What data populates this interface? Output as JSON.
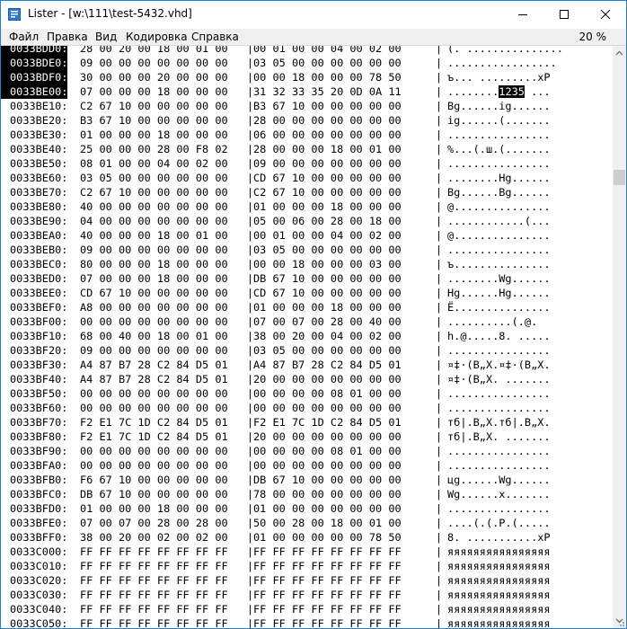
{
  "window": {
    "title": "Lister - [w:\\111\\test-5432.vhd]"
  },
  "menu": {
    "items": [
      "Файл",
      "Правка",
      "Вид",
      "Кодировка",
      "Справка"
    ],
    "zoom": "20 %"
  },
  "colors": {
    "selection": "#000000",
    "title_icon": "#2d7bd6",
    "border": "#1883d7"
  },
  "rows": [
    {
      "addr": "0033BDD0:",
      "hex1": "28 00 20 00 18 00 01 00",
      "hex2": "00 01 00 00 04 00 02 00",
      "ascii": "(. ...............",
      "sel": true,
      "selfrom": 2
    },
    {
      "addr": "0033BDE0:",
      "hex1": "09 00 00 00 00 00 00 00",
      "hex2": "03 05 00 00 00 00 00 00",
      "ascii": ".................",
      "sel": true,
      "selfrom": 2
    },
    {
      "addr": "0033BDF0:",
      "hex1": "30 00 00 00 20 00 00 00",
      "hex2": "00 00 18 00 00 00 78 50",
      "ascii": "ъ... .........xP",
      "sel": true,
      "selfrom": 2
    },
    {
      "addr": "0033BE00:",
      "hex1": "07 00 00 00 18 00 00 00",
      "hex2": "31 32 33 35 20 0D 0A 11",
      "ascii": "........",
      "asciihl": "1235",
      "asciitail": " ...",
      "sel": true,
      "selfrom": 2
    },
    {
      "addr": "0033BE10:",
      "hex1": "C2 67 10 00 00 00 00 00",
      "hex2": "B3 67 10 00 00 00 00 00",
      "ascii": "Bg......ig......"
    },
    {
      "addr": "0033BE20:",
      "hex1": "B3 67 10 00 00 00 00 00",
      "hex2": "28 00 00 00 00 00 00 00",
      "ascii": "ig......(......."
    },
    {
      "addr": "0033BE30:",
      "hex1": "01 00 00 00 18 00 00 00",
      "hex2": "06 00 00 00 00 00 00 00",
      "ascii": "................"
    },
    {
      "addr": "0033BE40:",
      "hex1": "25 00 00 00 28 00 F8 02",
      "hex2": "28 00 00 00 18 00 01 00",
      "ascii": "%...(.ш.(......."
    },
    {
      "addr": "0033BE50:",
      "hex1": "08 01 00 00 04 00 02 00",
      "hex2": "09 00 00 00 00 00 00 00",
      "ascii": "................"
    },
    {
      "addr": "0033BE60:",
      "hex1": "03 05 00 00 00 00 00 00",
      "hex2": "CD 67 10 00 00 00 00 00",
      "ascii": "........Hg......"
    },
    {
      "addr": "0033BE70:",
      "hex1": "C2 67 10 00 00 00 00 00",
      "hex2": "C2 67 10 00 00 00 00 00",
      "ascii": "Bg......Bg......"
    },
    {
      "addr": "0033BE80:",
      "hex1": "40 00 00 00 00 00 00 00",
      "hex2": "01 00 00 00 18 00 00 00",
      "ascii": "@..............."
    },
    {
      "addr": "0033BE90:",
      "hex1": "04 00 00 00 00 00 00 00",
      "hex2": "05 00 06 00 28 00 18 00",
      "ascii": "............(..."
    },
    {
      "addr": "0033BEA0:",
      "hex1": "40 00 00 00 18 00 01 00",
      "hex2": "00 01 00 00 04 00 02 00",
      "ascii": "@..............."
    },
    {
      "addr": "0033BEB0:",
      "hex1": "09 00 00 00 00 00 00 00",
      "hex2": "03 05 00 00 00 00 00 00",
      "ascii": "................"
    },
    {
      "addr": "0033BEC0:",
      "hex1": "80 00 00 00 18 00 00 00",
      "hex2": "00 00 18 00 00 00 03 00",
      "ascii": "ъ..............."
    },
    {
      "addr": "0033BED0:",
      "hex1": "07 00 00 00 18 00 00 00",
      "hex2": "DB 67 10 00 00 00 00 00",
      "ascii": "........Wg......"
    },
    {
      "addr": "0033BEE0:",
      "hex1": "CD 67 10 00 00 00 00 00",
      "hex2": "CD 67 10 00 00 00 00 00",
      "ascii": "Hg......Hg......"
    },
    {
      "addr": "0033BEF0:",
      "hex1": "A8 00 00 00 00 00 00 00",
      "hex2": "01 00 00 00 18 00 00 00",
      "ascii": "Ё..............."
    },
    {
      "addr": "0033BF00:",
      "hex1": "00 00 00 00 00 00 00 00",
      "hex2": "07 00 07 00 28 00 40 00",
      "ascii": "..........(.@."
    },
    {
      "addr": "0033BF10:",
      "hex1": "68 00 40 00 18 00 01 00",
      "hex2": "38 00 20 00 04 00 02 00",
      "ascii": "h.@.....8. ....."
    },
    {
      "addr": "0033BF20:",
      "hex1": "09 00 00 00 00 00 00 00",
      "hex2": "03 05 00 00 00 00 00 00",
      "ascii": "................"
    },
    {
      "addr": "0033BF30:",
      "hex1": "A4 87 B7 28 C2 84 D5 01",
      "hex2": "A4 87 B7 28 C2 84 D5 01",
      "ascii": "¤‡·(B„Х.¤‡·(B„Х."
    },
    {
      "addr": "0033BF40:",
      "hex1": "A4 87 B7 28 C2 84 D5 01",
      "hex2": "20 00 00 00 00 00 00 00",
      "ascii": "¤‡·(B„Х. ......."
    },
    {
      "addr": "0033BF50:",
      "hex1": "00 00 00 00 00 00 00 00",
      "hex2": "00 00 00 00 08 01 00 00",
      "ascii": "................"
    },
    {
      "addr": "0033BF60:",
      "hex1": "00 00 00 00 00 00 00 00",
      "hex2": "00 00 00 00 00 00 00 00",
      "ascii": "................"
    },
    {
      "addr": "0033BF70:",
      "hex1": "F2 E1 7C 1D C2 84 D5 01",
      "hex2": "F2 E1 7C 1D C2 84 D5 01",
      "ascii": "тб|.B„Х.тб|.B„Х."
    },
    {
      "addr": "0033BF80:",
      "hex1": "F2 E1 7C 1D C2 84 D5 01",
      "hex2": "20 00 00 00 00 00 00 00",
      "ascii": "тб|.B„Х. ......."
    },
    {
      "addr": "0033BF90:",
      "hex1": "00 00 00 00 00 00 00 00",
      "hex2": "00 00 00 00 08 01 00 00",
      "ascii": "................"
    },
    {
      "addr": "0033BFA0:",
      "hex1": "00 00 00 00 00 00 00 00",
      "hex2": "00 00 00 00 00 00 00 00",
      "ascii": "................"
    },
    {
      "addr": "0033BFB0:",
      "hex1": "F6 67 10 00 00 00 00 00",
      "hex2": "DB 67 10 00 00 00 00 00",
      "ascii": "цg......Wg......"
    },
    {
      "addr": "0033BFC0:",
      "hex1": "DB 67 10 00 00 00 00 00",
      "hex2": "78 00 00 00 00 00 00 00",
      "ascii": "Wg......x......."
    },
    {
      "addr": "0033BFD0:",
      "hex1": "01 00 00 00 18 00 00 00",
      "hex2": "01 00 00 00 00 00 00 00",
      "ascii": "................"
    },
    {
      "addr": "0033BFE0:",
      "hex1": "07 00 07 00 28 00 28 00",
      "hex2": "50 00 28 00 18 00 01 00",
      "ascii": "....(.(.P.(....."
    },
    {
      "addr": "0033BFF0:",
      "hex1": "38 00 20 00 02 00 02 00",
      "hex2": "01 00 00 00 00 00 78 50",
      "ascii": "8. ...........xP"
    },
    {
      "addr": "0033C000:",
      "hex1": "FF FF FF FF FF FF FF FF",
      "hex2": "FF FF FF FF FF FF FF FF",
      "ascii": "яяяяяяяяяяяяяяяя"
    },
    {
      "addr": "0033C010:",
      "hex1": "FF FF FF FF FF FF FF FF",
      "hex2": "FF FF FF FF FF FF FF FF",
      "ascii": "яяяяяяяяяяяяяяяя"
    },
    {
      "addr": "0033C020:",
      "hex1": "FF FF FF FF FF FF FF FF",
      "hex2": "FF FF FF FF FF FF FF FF",
      "ascii": "яяяяяяяяяяяяяяяя"
    },
    {
      "addr": "0033C030:",
      "hex1": "FF FF FF FF FF FF FF FF",
      "hex2": "FF FF FF FF FF FF FF FF",
      "ascii": "яяяяяяяяяяяяяяяя"
    },
    {
      "addr": "0033C040:",
      "hex1": "FF FF FF FF FF FF FF FF",
      "hex2": "FF FF FF FF FF FF FF FF",
      "ascii": "яяяяяяяяяяяяяяяя"
    },
    {
      "addr": "0033C050:",
      "hex1": "FF FF FF FF FF FF FF FF",
      "hex2": "FF FF FF FF FF FF FF FF",
      "ascii": "яяяяяяяяяяяяяяяя"
    }
  ]
}
